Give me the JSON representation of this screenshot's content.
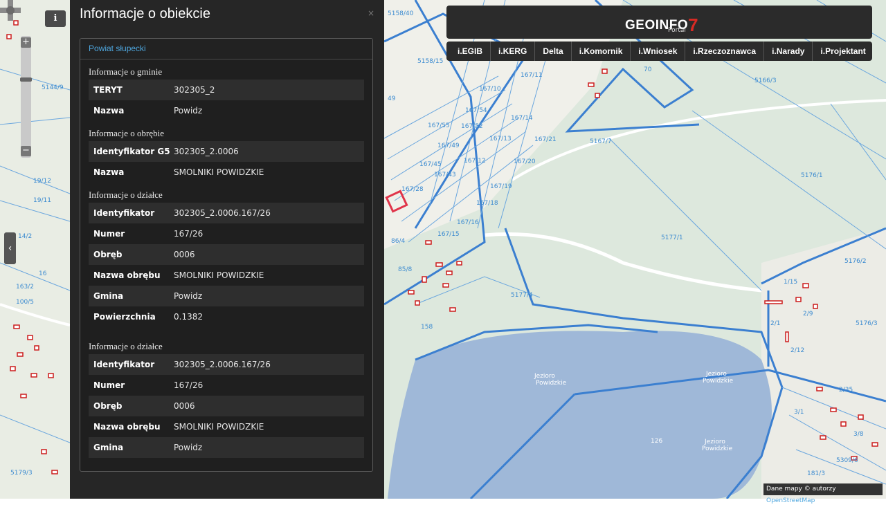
{
  "panel": {
    "title": "Informacje o obiekcie",
    "close": "×",
    "tab": "Powiat słupecki",
    "sections": [
      {
        "title": "Informacje o gminie",
        "rows": [
          {
            "key": "TERYT",
            "value": "302305_2"
          },
          {
            "key": "Nazwa",
            "value": "Powidz"
          }
        ]
      },
      {
        "title": "Informacje o obrębie",
        "rows": [
          {
            "key": "Identyfikator G5",
            "value": "302305_2.0006"
          },
          {
            "key": "Nazwa",
            "value": "SMOLNIKI POWIDZKIE"
          }
        ]
      },
      {
        "title": "Informacje o działce",
        "rows": [
          {
            "key": "Identyfikator",
            "value": "302305_2.0006.167/26"
          },
          {
            "key": "Numer",
            "value": "167/26"
          },
          {
            "key": "Obręb",
            "value": "0006"
          },
          {
            "key": "Nazwa obrębu",
            "value": "SMOLNIKI POWIDZKIE"
          },
          {
            "key": "Gmina",
            "value": "Powidz"
          },
          {
            "key": "Powierzchnia",
            "value": "0.1382"
          }
        ]
      },
      {
        "title": "Informacje o działce",
        "rows": [
          {
            "key": "Identyfikator",
            "value": "302305_2.0006.167/26"
          },
          {
            "key": "Numer",
            "value": "167/26"
          },
          {
            "key": "Obręb",
            "value": "0006"
          },
          {
            "key": "Nazwa obrębu",
            "value": "SMOLNIKI POWIDZKIE"
          },
          {
            "key": "Gmina",
            "value": "Powidz"
          }
        ]
      }
    ]
  },
  "header": {
    "brand": "GEOINFO",
    "brand_number": "7",
    "brand_sub": "Portal",
    "menu": [
      "i.EGIB",
      "i.KERG",
      "Delta",
      "i.Komornik",
      "i.Wniosek",
      "i.Rzeczoznawca",
      "i.Narady",
      "i.Projektant"
    ]
  },
  "controls": {
    "info_icon": "i",
    "zoom_in": "+",
    "zoom_out": "−",
    "collapse": "‹"
  },
  "attribution": {
    "text": "Dane mapy © autorzy ",
    "link": "OpenStreetMap"
  },
  "map_labels": {
    "parcels": [
      "5158/40",
      "5158/15",
      "5144/9",
      "167/10",
      "167/11",
      "167/54",
      "167/55",
      "167/52",
      "167/14",
      "167/13",
      "167/21",
      "167/49",
      "167/12",
      "167/20",
      "167/45",
      "167/43",
      "167/28",
      "167/19",
      "167/18",
      "167/16",
      "167/15",
      "5167/7",
      "5166/3",
      "5176/1",
      "5177/1",
      "5176/2",
      "5176/3",
      "5177/4",
      "19/12",
      "19/11",
      "14/2",
      "163/2",
      "100/5",
      "86/4",
      "85/8",
      "2/1",
      "2/12",
      "2/35",
      "3/1",
      "3/8",
      "1/15",
      "2/9",
      "5309/6",
      "181/3",
      "5179/3",
      "49",
      "70",
      "16",
      "158",
      "126"
    ],
    "lake_names": [
      "Jezioro Powidzkie",
      "Jezioro Powidzkie",
      "Jezioro Powidzkie"
    ]
  }
}
